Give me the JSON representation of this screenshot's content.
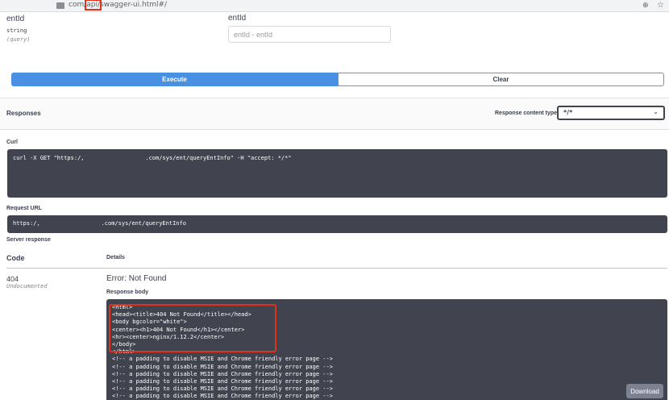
{
  "browser": {
    "url_prefix": "com/",
    "url_highlight": "api/",
    "url_suffix": "swagger-ui.html#/",
    "translate_glyph": "⊕",
    "star_glyph": "☆"
  },
  "parameter": {
    "name": "entId",
    "type": "string",
    "location": "(query)",
    "description": "entId",
    "placeholder": "entId - entId"
  },
  "actions": {
    "execute_label": "Execute",
    "clear_label": "Clear"
  },
  "responses": {
    "title": "Responses",
    "content_type_label": "Response content type",
    "content_type_value": "*/*",
    "chevron_glyph": "⌄"
  },
  "curl": {
    "label": "Curl",
    "command": "curl -X GET \"https:/,                  .com/sys/ent/queryEntInfo\" -H \"accept: */*\""
  },
  "request_url": {
    "label": "Request URL",
    "value": "https:/,                  .com/sys/ent/queryEntInfo"
  },
  "server_response": {
    "label": "Server response",
    "col_code": "Code",
    "col_details": "Details",
    "code": "404",
    "undocumented": "Undocumented",
    "error_title": "Error: Not Found",
    "body_label": "Response body",
    "body_lines": [
      "<html>",
      "<head><title>404 Not Found</title></head>",
      "<body bgcolor=\"white\">",
      "<center><h1>404 Not Found</h1></center>",
      "<hr><center>nginx/1.12.2</center>",
      "</body>",
      "</html>",
      "<!-- a padding to disable MSIE and Chrome friendly error page -->",
      "<!-- a padding to disable MSIE and Chrome friendly error page -->",
      "<!-- a padding to disable MSIE and Chrome friendly error page -->",
      "<!-- a padding to disable MSIE and Chrome friendly error page -->",
      "<!-- a padding to disable MSIE and Chrome friendly error page -->",
      "<!-- a padding to disable MSIE and Chrome friendly error page -->"
    ],
    "download_label": "Download"
  },
  "colors": {
    "execute_blue": "#4990e2",
    "code_bg": "#41444e",
    "annotation_red": "#e0321b"
  }
}
